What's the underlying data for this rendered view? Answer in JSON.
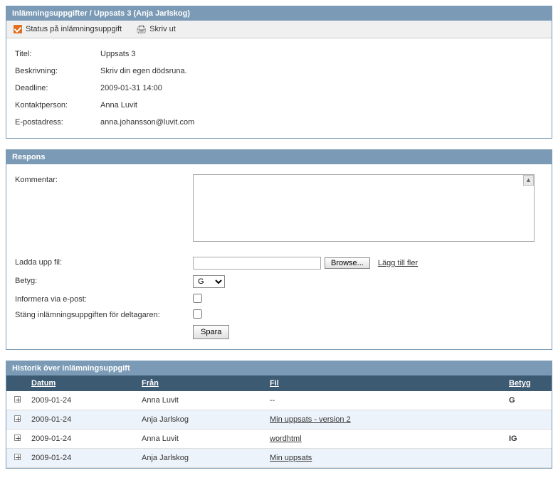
{
  "header": {
    "title": "Inlämningsuppgifter / Uppsats 3 (Anja Jarlskog)"
  },
  "toolbar": {
    "status_label": "Status på inlämningsuppgift",
    "print_label": "Skriv ut"
  },
  "details": {
    "titel_label": "Titel:",
    "titel_value": "Uppsats 3",
    "beskrivning_label": "Beskrivning:",
    "beskrivning_value": "Skriv din egen dödsruna.",
    "deadline_label": "Deadline:",
    "deadline_value": "2009-01-31 14:00",
    "kontakt_label": "Kontaktperson:",
    "kontakt_value": "Anna Luvit",
    "epost_label": "E-postadress:",
    "epost_value": "anna.johansson@luvit.com"
  },
  "respons": {
    "header": "Respons",
    "kommentar_label": "Kommentar:",
    "kommentar_value": "",
    "ladda_label": "Ladda upp fil:",
    "file_value": "",
    "browse_label": "Browse...",
    "add_more_label": "Lägg till fler",
    "betyg_label": "Betyg:",
    "betyg_value": "G",
    "informera_label": "Informera via e-post:",
    "stang_label": "Stäng inlämningsuppgiften för deltagaren:",
    "spara_label": "Spara"
  },
  "history": {
    "header": "Historik över inlämningsuppgift",
    "col_datum": "Datum",
    "col_fran": "Från",
    "col_fil": "Fil",
    "col_betyg": "Betyg",
    "rows": [
      {
        "datum": "2009-01-24",
        "fran": "Anna Luvit",
        "fil": "--",
        "fil_link": false,
        "betyg": "G"
      },
      {
        "datum": "2009-01-24",
        "fran": "Anja Jarlskog",
        "fil": "Min uppsats - version 2",
        "fil_link": true,
        "betyg": ""
      },
      {
        "datum": "2009-01-24",
        "fran": "Anna Luvit",
        "fil": "wordhtml",
        "fil_link": true,
        "betyg": "IG"
      },
      {
        "datum": "2009-01-24",
        "fran": "Anja Jarlskog",
        "fil": "Min uppsats",
        "fil_link": true,
        "betyg": ""
      }
    ]
  }
}
